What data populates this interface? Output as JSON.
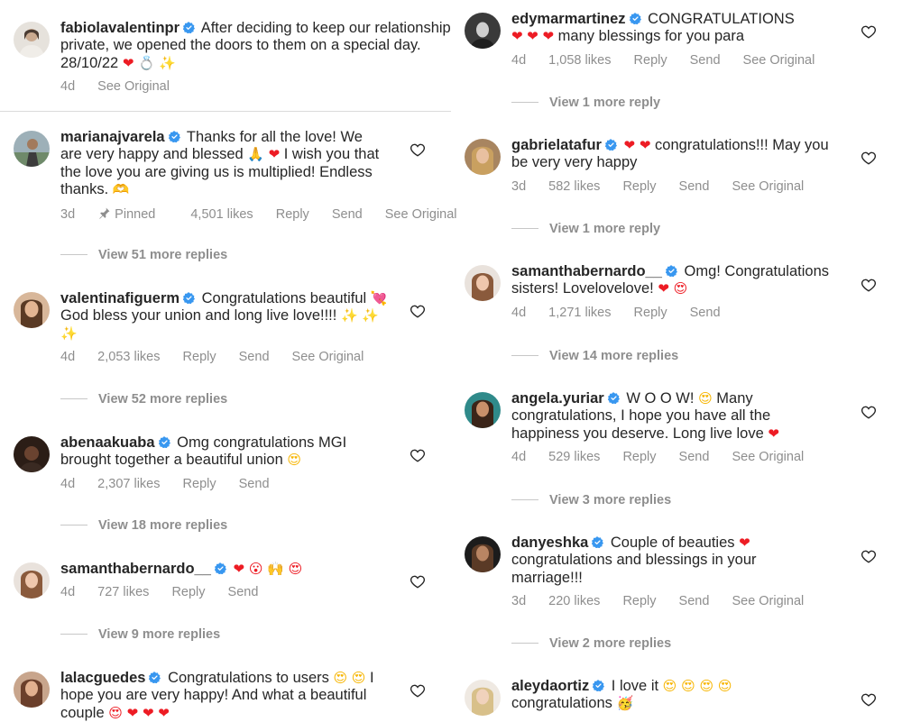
{
  "left": {
    "caption": {
      "username": "fabiolavalentinpr",
      "text": "After deciding to keep our relationship private, we opened the doors to them on a special day. 28/10/22",
      "emoji": [
        "❤",
        "💍",
        "✨"
      ],
      "time": "4d",
      "see_original": "See Original"
    },
    "comments": [
      {
        "username": "marianajvarela",
        "text": "Thanks for all the love! We are very happy and blessed",
        "emoji_1": "🙏",
        "emoji_2": "❤",
        "text_2": "I wish you that the love you are giving us is multiplied! Endless thanks.",
        "emoji_3": "🫶",
        "time": "3d",
        "pinned": "Pinned",
        "likes": "4,501 likes",
        "reply": "Reply",
        "send": "Send",
        "see_original": "See Original",
        "replies": "View 51 more replies"
      },
      {
        "username": "valentinafiguerm",
        "text": "Congratulations beautiful",
        "emoji_1": "💘",
        "text_2": "God bless your union and long live love!!!!",
        "emoji_2": "✨ ✨ ✨",
        "time": "4d",
        "likes": "2,053 likes",
        "reply": "Reply",
        "send": "Send",
        "see_original": "See Original",
        "replies": "View 52 more replies"
      },
      {
        "username": "abenaakuaba",
        "text": "Omg congratulations MGI brought together a beautiful union",
        "emoji_1": "😍",
        "time": "4d",
        "likes": "2,307 likes",
        "reply": "Reply",
        "send": "Send",
        "replies": "View 18 more replies"
      },
      {
        "username": "samanthabernardo__",
        "emoji_1": "❤ 😮 🙌 😍",
        "time": "4d",
        "likes": "727 likes",
        "reply": "Reply",
        "send": "Send",
        "replies": "View 9 more replies"
      },
      {
        "username": "lalacguedes",
        "text": "Congratulations to users",
        "emoji_1": "😍",
        "emoji_2": "😍",
        "text_2": "I hope you are very happy! And what a beautiful couple",
        "emoji_3": "😍 ❤ ❤ ❤"
      }
    ]
  },
  "right": {
    "comments": [
      {
        "username": "edymarmartinez",
        "text": "CONGRATULATIONS",
        "emoji_1": "❤",
        "emoji_2": "❤ ❤",
        "text_2": "many blessings for you para",
        "time": "4d",
        "likes": "1,058 likes",
        "reply": "Reply",
        "send": "Send",
        "see_original": "See Original",
        "replies": "View 1 more reply"
      },
      {
        "username": "gabrielatafur",
        "emoji_1": "❤ ❤",
        "text": "congratulations!!! May you be very very happy",
        "time": "3d",
        "likes": "582 likes",
        "reply": "Reply",
        "send": "Send",
        "see_original": "See Original",
        "replies": "View 1 more reply"
      },
      {
        "username": "samanthabernardo__",
        "text": "Omg! Congratulations sisters! Lovelovelove!",
        "emoji_1": "❤ 😍",
        "time": "4d",
        "likes": "1,271 likes",
        "reply": "Reply",
        "send": "Send",
        "replies": "View 14 more replies"
      },
      {
        "username": "angela.yuriar",
        "text": "W O O W!",
        "emoji_1": "😍",
        "text_2": "Many congratulations, I hope you have all the happiness you deserve. Long live love",
        "emoji_2": "❤",
        "time": "4d",
        "likes": "529 likes",
        "reply": "Reply",
        "send": "Send",
        "see_original": "See Original",
        "replies": "View 3 more replies"
      },
      {
        "username": "danyeshka",
        "text": "Couple of beauties",
        "emoji_1": "❤",
        "text_2": "congratulations and blessings in your marriage!!!",
        "time": "3d",
        "likes": "220 likes",
        "reply": "Reply",
        "send": "Send",
        "see_original": "See Original",
        "replies": "View 2 more replies"
      },
      {
        "username": "aleydaortiz",
        "text": "I love it",
        "emoji_1": "😍 😍 😍 😍",
        "text_2": "congratulations",
        "emoji_2": "🥳"
      }
    ]
  },
  "colors": {
    "text": "#262626",
    "muted": "#8e8e8e",
    "verified": "#3897f0",
    "heart_red": "#ed1c24",
    "separator": "#dbdbdb"
  },
  "icons": {
    "verified": "verified-badge-icon",
    "like": "heart-outline-icon",
    "pin": "pin-icon"
  }
}
